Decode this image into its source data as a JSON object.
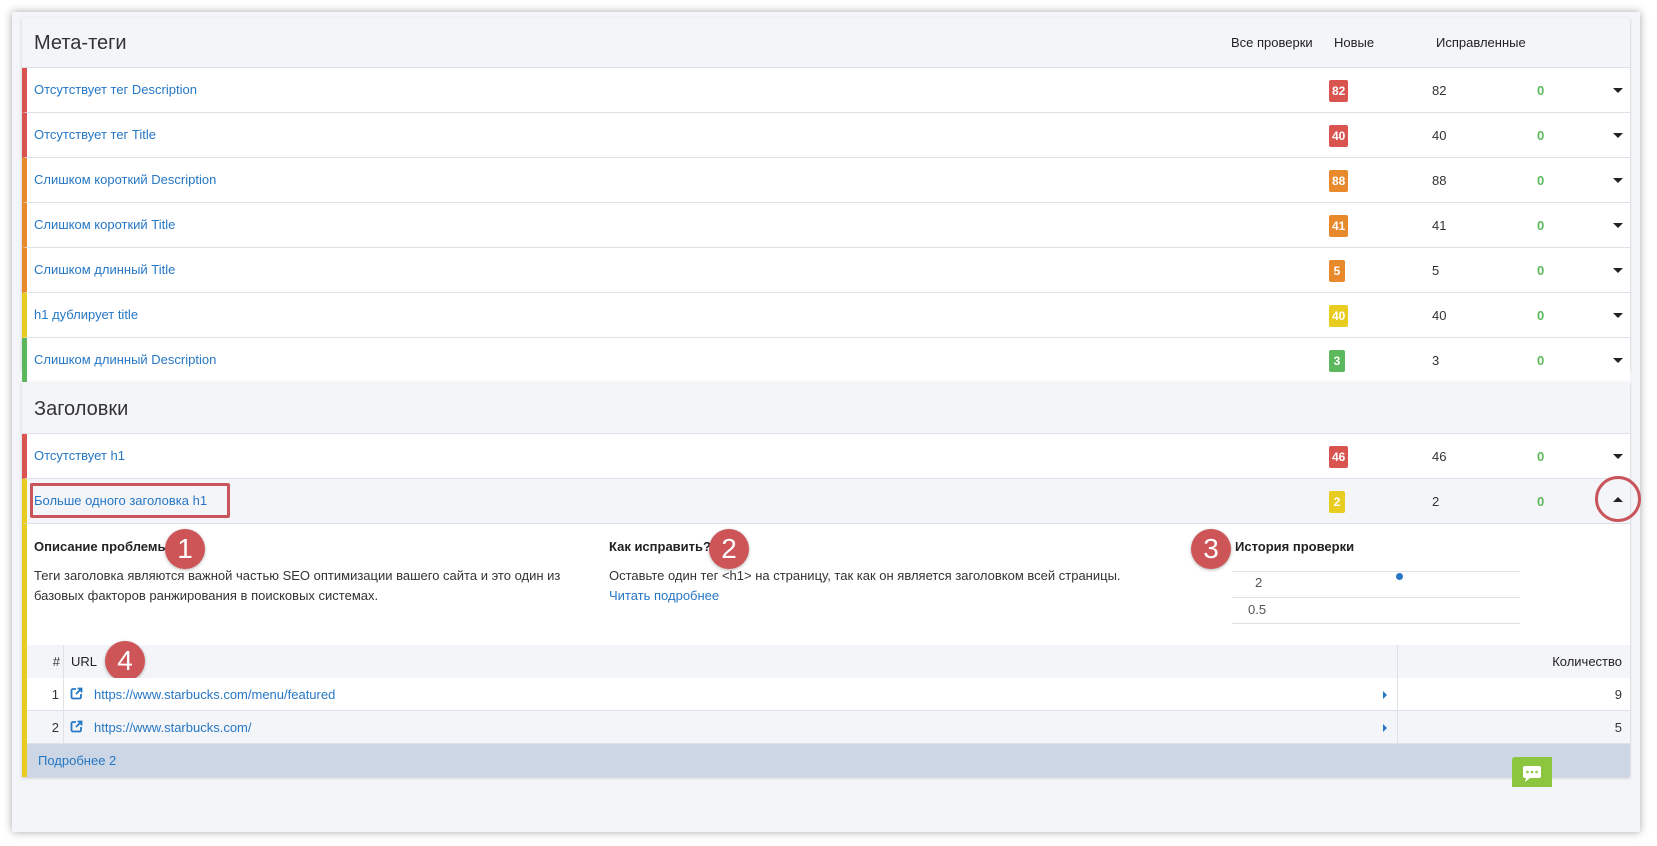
{
  "meta_section": {
    "title": "Мета-теги",
    "col_all": "Все проверки",
    "col_new": "Новые",
    "col_fixed": "Исправленные",
    "rows": [
      {
        "label": "Отсутствует тег Description",
        "all": "82",
        "new": "82",
        "fixed": "0",
        "level": "red"
      },
      {
        "label": "Отсутствует тег Title",
        "all": "40",
        "new": "40",
        "fixed": "0",
        "level": "red"
      },
      {
        "label": "Слишком короткий Description",
        "all": "88",
        "new": "88",
        "fixed": "0",
        "level": "orange"
      },
      {
        "label": "Слишком короткий Title",
        "all": "41",
        "new": "41",
        "fixed": "0",
        "level": "orange"
      },
      {
        "label": "Слишком длинный Title",
        "all": "5",
        "new": "5",
        "fixed": "0",
        "level": "orange"
      },
      {
        "label": "h1 дублирует title",
        "all": "40",
        "new": "40",
        "fixed": "0",
        "level": "yellow"
      },
      {
        "label": "Слишком длинный Description",
        "all": "3",
        "new": "3",
        "fixed": "0",
        "level": "green"
      }
    ]
  },
  "headings_section": {
    "title": "Заголовки",
    "rows": [
      {
        "label": "Отсутствует h1",
        "all": "46",
        "new": "46",
        "fixed": "0",
        "level": "red"
      },
      {
        "label": "Больше одного заголовка h1",
        "all": "2",
        "new": "2",
        "fixed": "0",
        "level": "yellow"
      }
    ]
  },
  "details": {
    "problem_title": "Описание проблемы",
    "problem_text": "Теги заголовка являются важной частью SEO оптимизации вашего сайта и это один из базовых факторов ранжирования в поисковых системах.",
    "fix_title": "Как исправить?",
    "fix_text": "Оставьте один тег <h1> на страницу, так как он является заголовком всей страницы.",
    "fix_link": "Читать подробнее",
    "history_title": "История проверки",
    "history_labels": [
      "2",
      "0.5"
    ],
    "markers": [
      "1",
      "2",
      "3",
      "4"
    ]
  },
  "url_table": {
    "col_num": "#",
    "col_url": "URL",
    "col_qty": "Количество",
    "rows": [
      {
        "num": "1",
        "url": "https://www.starbucks.com/menu/featured",
        "qty": "9"
      },
      {
        "num": "2",
        "url": "https://www.starbucks.com/",
        "qty": "5"
      }
    ],
    "more": "Подробнее 2"
  },
  "colors": {
    "red": "#d9534f",
    "orange": "#e8892b",
    "yellow": "#e8cc20",
    "green": "#5cb85c",
    "link": "#2677c4",
    "marker": "#cd5457"
  },
  "icons": {
    "caret": "caret-down-icon",
    "external": "external-link-icon",
    "chat": "chat-icon"
  }
}
